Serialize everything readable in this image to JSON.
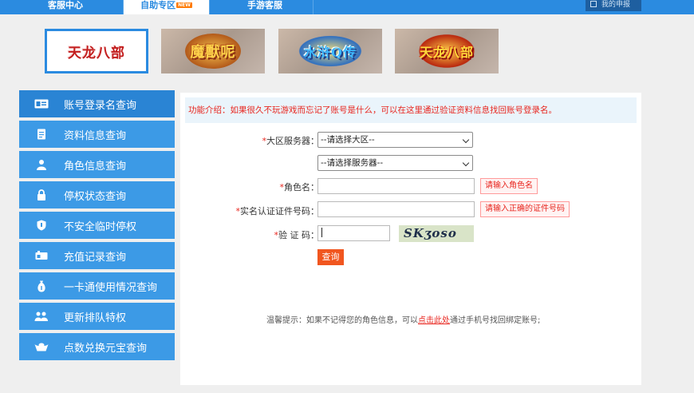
{
  "nav": {
    "tabs": [
      {
        "label": "客服中心",
        "active": false
      },
      {
        "label": "自助专区",
        "active": true,
        "badge": "NEW"
      },
      {
        "label": "手游客服",
        "active": false
      }
    ],
    "my_order": "我的申报"
  },
  "games": [
    {
      "name": "天龙八部",
      "active": true
    },
    {
      "name": "魔獸呢",
      "active": false
    },
    {
      "name": "水浒Q传",
      "active": false
    },
    {
      "name": "天龙八部",
      "active": false
    }
  ],
  "sidebar": {
    "items": [
      {
        "label": "账号登录名查询",
        "icon": "id-card-icon",
        "active": true
      },
      {
        "label": "资料信息查询",
        "icon": "document-icon",
        "active": false
      },
      {
        "label": "角色信息查询",
        "icon": "user-icon",
        "active": false
      },
      {
        "label": "停权状态查询",
        "icon": "lock-icon",
        "active": false
      },
      {
        "label": "不安全临时停权",
        "icon": "shield-icon",
        "active": false
      },
      {
        "label": "充值记录查询",
        "icon": "card-icon",
        "active": false
      },
      {
        "label": "一卡通使用情况查询",
        "icon": "money-bag-icon",
        "active": false
      },
      {
        "label": "更新排队特权",
        "icon": "group-icon",
        "active": false
      },
      {
        "label": "点数兑换元宝查询",
        "icon": "ingot-icon",
        "active": false
      }
    ]
  },
  "form": {
    "intro": "功能介绍：如果很久不玩游戏而忘记了账号是什么，可以在这里通过验证资料信息找回账号登录名。",
    "region_label": "大区服务器：",
    "region_select": "--请选择大区--",
    "server_select": "--请选择服务器--",
    "role_label": "角色名：",
    "role_value": "",
    "role_hint": "请输入角色名",
    "id_label": "实名认证证件号码：",
    "id_value": "",
    "id_hint": "请输入正确的证件号码",
    "captcha_label": "验 证 码：",
    "captcha_value": "",
    "captcha_text": "SKʒoso",
    "submit_label": "查询",
    "required_mark": "*"
  },
  "tip": {
    "prefix": "温馨提示：如果不记得您的角色信息，可以",
    "link": "点击此处",
    "suffix": "通过手机号找回绑定账号;"
  }
}
